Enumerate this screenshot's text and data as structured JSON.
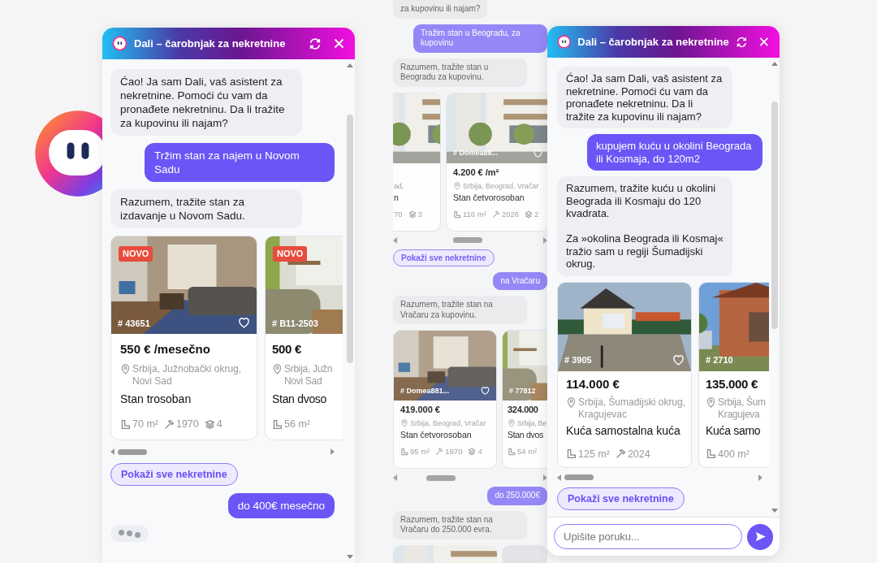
{
  "panels": [
    {
      "kind": "window",
      "title": "Dali – čarobnjak za nekretnine",
      "messages": [
        {
          "kind": "bot",
          "text": "Ćao! Ja sam Dali, vaš asistent za nekretnine. Pomoći ću vam da pronađete nekretninu. Da li tražite za kupovinu ili najam?"
        },
        {
          "kind": "user",
          "text": "Tržim stan za najem u Novom Sadu"
        },
        {
          "kind": "bot",
          "text": "Razumem, tražite stan za izdavanje u Novom Sadu."
        },
        {
          "kind": "listings",
          "cards": [
            {
              "kind": "full",
              "badge": "NOVO",
              "id": "# 43651",
              "price": "550 € /mesečno",
              "location": [
                "Srbija, Južnobački okrug,",
                "Novi Sad"
              ],
              "title": "Stan trosoban",
              "features": [
                {
                  "kind": "area",
                  "text": "70 m²"
                },
                {
                  "kind": "year",
                  "text": "1970"
                },
                {
                  "kind": "floors",
                  "text": "4"
                }
              ]
            },
            {
              "kind": "cut_right",
              "badge": "NOVO",
              "id": "# B11-2503",
              "price": "500 €",
              "location": [
                "Srbija, Južn",
                "Novi Sad"
              ],
              "title": "Stan dvoso",
              "features": [
                {
                  "kind": "area",
                  "text": "56 m²"
                }
              ]
            }
          ]
        },
        {
          "kind": "button",
          "text": "Pokaži sve nekretnine"
        },
        {
          "kind": "user",
          "text": "do 400€ mesečno"
        },
        {
          "kind": "typing"
        }
      ]
    },
    {
      "kind": "faded",
      "messages": [
        {
          "kind": "bot",
          "text": "za kupovinu ili najam?"
        },
        {
          "kind": "user",
          "text": "Tražim stan u Beogradu, za kupovinu"
        },
        {
          "kind": "bot",
          "text": "Razumem, tražite stan u Beogradu za kupovinu."
        },
        {
          "kind": "listings",
          "cards": [
            {
              "kind": "cut_left",
              "location": [
                "ad,"
              ],
              "title": "n",
              "features": [
                {
                  "kind": "plain",
                  "text": "70"
                },
                {
                  "kind": "floors",
                  "text": "3"
                }
              ]
            },
            {
              "kind": "full",
              "id": "# Domea88...",
              "price": "4.200 € /m²",
              "location": [
                "Srbija, Beograd, Vračar"
              ],
              "title": "Stan četvorosoban",
              "features": [
                {
                  "kind": "area",
                  "text": "116 m²"
                },
                {
                  "kind": "year",
                  "text": "2026"
                },
                {
                  "kind": "floors",
                  "text": "2"
                }
              ]
            }
          ]
        },
        {
          "kind": "button",
          "text": "Pokaži sve nekretnine"
        },
        {
          "kind": "user",
          "text": "na Vračaru"
        },
        {
          "kind": "bot",
          "text": "Razumem, tražite stan na Vračaru za kupovinu."
        },
        {
          "kind": "listings",
          "cards": [
            {
              "kind": "full",
              "id": "# Domea881...",
              "price": "419.000 €",
              "location": [
                "Srbija, Beograd, Vračar"
              ],
              "title": "Stan četvorosoban",
              "features": [
                {
                  "kind": "area",
                  "text": "95 m²"
                },
                {
                  "kind": "year",
                  "text": "1970"
                },
                {
                  "kind": "floors",
                  "text": "4"
                }
              ]
            },
            {
              "kind": "cut_right",
              "id": "# 77812",
              "price": "324.000",
              "location": [
                "Srbija, Be"
              ],
              "title": "Stan dvos",
              "features": [
                {
                  "kind": "area",
                  "text": "54 m²"
                }
              ]
            }
          ]
        },
        {
          "kind": "user",
          "text": "do 250.000€"
        },
        {
          "kind": "bot",
          "text": "Razumem, tražite stan na Vračaru do 250.000 evra."
        },
        {
          "kind": "photos",
          "cards": [
            {
              "kind": "picture"
            },
            {
              "kind": "placeholder"
            }
          ]
        }
      ]
    },
    {
      "kind": "window",
      "title": "Dali – čarobnjak za nekretnine",
      "messages": [
        {
          "kind": "bot",
          "text": "Ćao! Ja sam Dali, vaš asistent za nekretnine. Pomoći ću vam da pronađete nekretninu. Da li tražite za kupovinu ili najam?"
        },
        {
          "kind": "user",
          "text": "kupujem kuću u okolini Beograda ili Kosmaja, do 120m2"
        },
        {
          "kind": "bot",
          "text": "Razumem, tražite kuću u okolini Beograda ili Kosmaju do 120 kvadrata.\n\nZa »okolina Beograda ili Kosmaj« tražio sam u regiji Šumadijski okrug."
        },
        {
          "kind": "listings",
          "cards": [
            {
              "kind": "full",
              "id": "# 3905",
              "price": "114.000 €",
              "location": [
                "Srbija, Šumadijski okrug,",
                "Kragujevac"
              ],
              "title": "Kuća samostalna kuća",
              "features": [
                {
                  "kind": "area",
                  "text": "125 m²"
                },
                {
                  "kind": "year",
                  "text": "2024"
                }
              ]
            },
            {
              "kind": "cut_right",
              "id": "# 2710",
              "price": "135.000 €",
              "location": [
                "Srbija, Šum",
                "Kragujeva"
              ],
              "title": "Kuća samo",
              "features": [
                {
                  "kind": "area",
                  "text": "400 m²"
                }
              ]
            }
          ]
        },
        {
          "kind": "button",
          "text": "Pokaži sve nekretnine"
        }
      ],
      "input": {
        "placeholder": "Upišite poruku..."
      }
    }
  ]
}
